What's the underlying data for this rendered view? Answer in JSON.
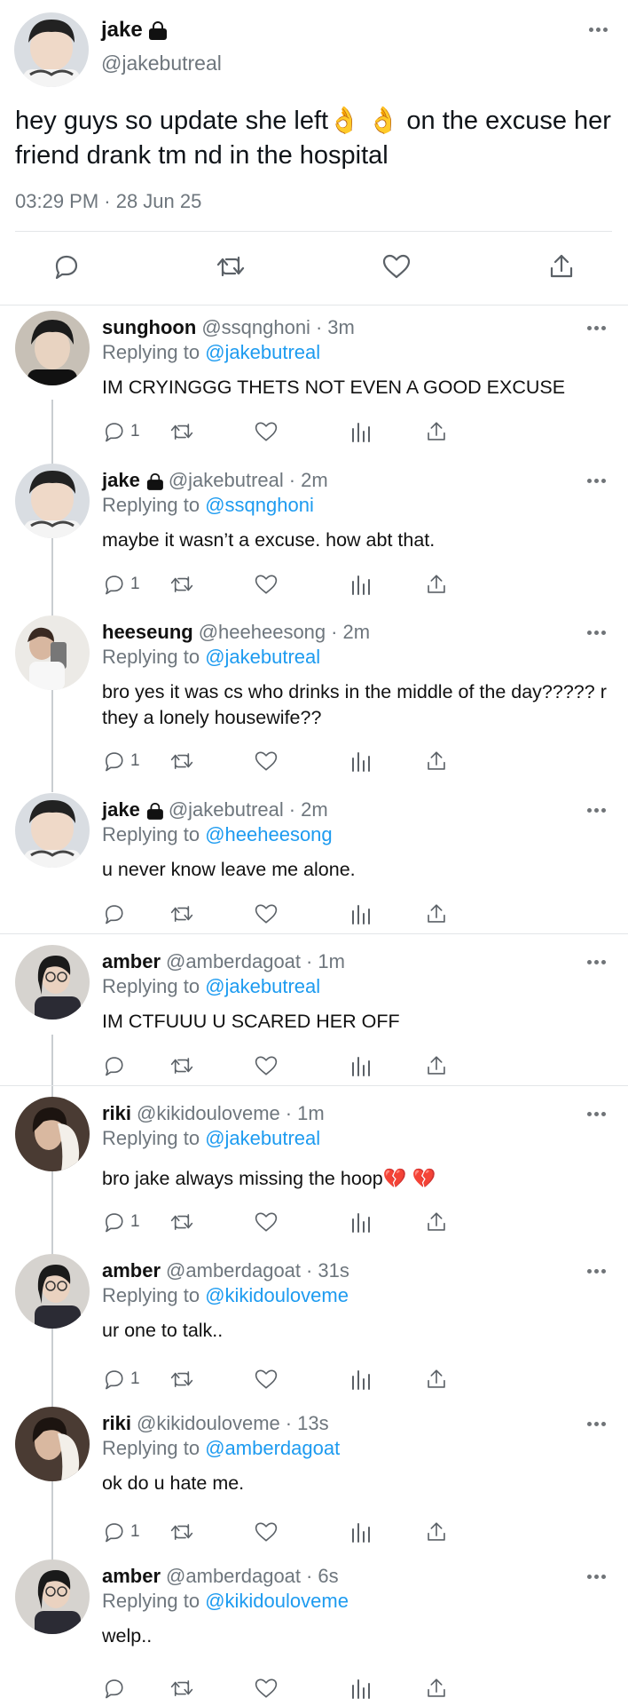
{
  "main": {
    "name": "jake",
    "handle": "@jakebutreal",
    "text": "hey guys so update she left👌 👌  on the excuse her friend drank tm nd in the hospital",
    "time": "03:29 PM · 28 Jun 25"
  },
  "replies": [
    {
      "name": "sunghoon",
      "handle": "@ssqnghoni",
      "age": "3m",
      "to": "@jakebutreal",
      "text": "IM CRYINGGG THETS NOT EVEN A GOOD EXCUSE",
      "reply_count": "1",
      "locked": false
    },
    {
      "name": "jake",
      "handle": "@jakebutreal",
      "age": "2m",
      "to": "@ssqnghoni",
      "text": "maybe it wasn’t a excuse. how abt that.",
      "reply_count": "1",
      "locked": true
    },
    {
      "name": "heeseung",
      "handle": "@heeheesong",
      "age": "2m",
      "to": "@jakebutreal",
      "text": "bro yes it was cs who drinks in the middle of the day????? r they a lonely housewife??",
      "reply_count": "1",
      "locked": false
    },
    {
      "name": "jake",
      "handle": "@jakebutreal",
      "age": "2m",
      "to": "@heeheesong",
      "text": "u never know leave me alone.",
      "reply_count": "",
      "locked": true
    },
    {
      "name": "amber",
      "handle": "@amberdagoat",
      "age": "1m",
      "to": "@jakebutreal",
      "text": "IM CTFUUU U SCARED HER OFF",
      "reply_count": "",
      "locked": false
    },
    {
      "name": "riki",
      "handle": "@kikidouloveme",
      "age": "1m",
      "to": "@jakebutreal",
      "text": "bro jake always missing the hoop💔 💔",
      "reply_count": "1",
      "locked": false
    },
    {
      "name": "amber",
      "handle": "@amberdagoat",
      "age": "31s",
      "to": "@kikidouloveme",
      "text": "ur one to talk..",
      "reply_count": "1",
      "locked": false
    },
    {
      "name": "riki",
      "handle": "@kikidouloveme",
      "age": "13s",
      "to": "@amberdagoat",
      "text": "ok do u hate me.",
      "reply_count": "1",
      "locked": false
    },
    {
      "name": "amber",
      "handle": "@amberdagoat",
      "age": "6s",
      "to": "@kikidouloveme",
      "text": "welp..",
      "reply_count": "",
      "locked": false
    }
  ],
  "labels": {
    "replying_prefix": "Replying to",
    "dot": "·"
  },
  "colors": {
    "link": "#1d9bf0",
    "muted": "#6e767d",
    "icon": "#5b6167"
  }
}
